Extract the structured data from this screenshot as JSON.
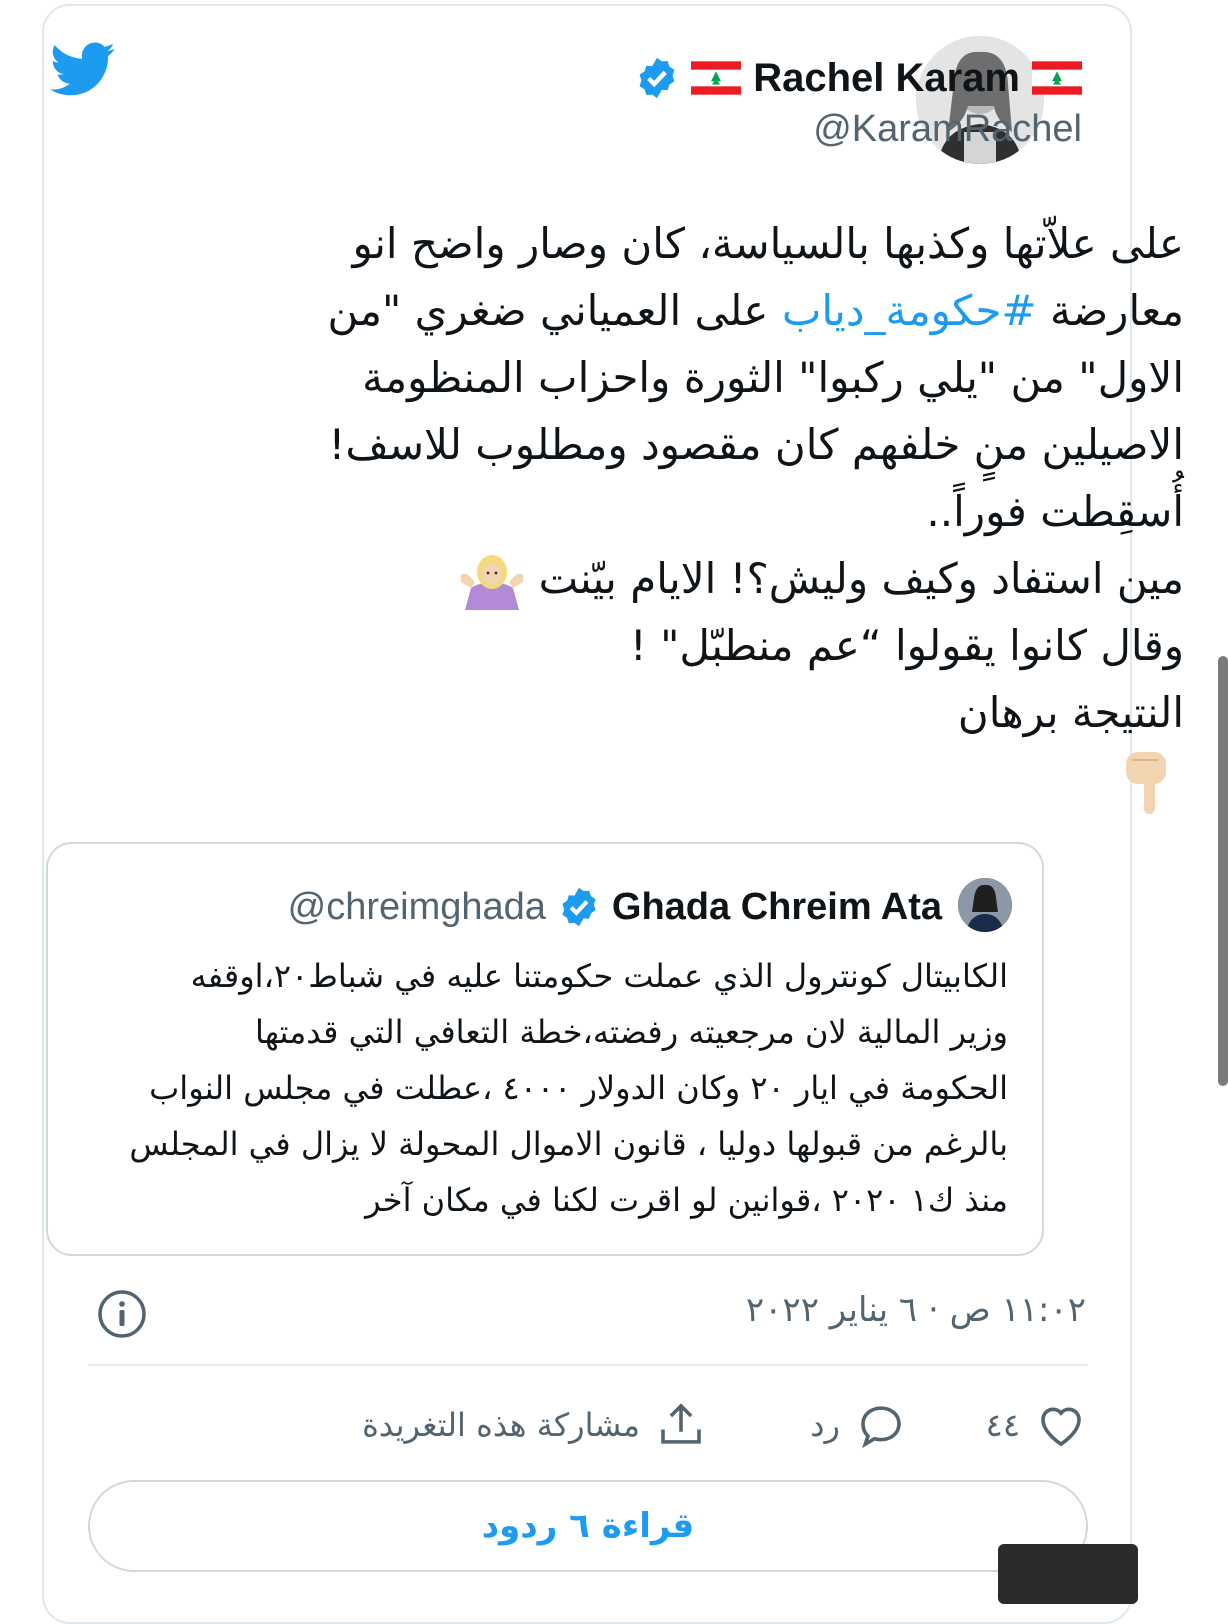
{
  "tweet": {
    "author_name": "Rachel Karam",
    "author_handle": "@KaramRachel",
    "lines": [
      {
        "before": "على علاّتها وكذبها بالسياسة، كان وصار واضح انو",
        "hashtag": "",
        "after": ""
      },
      {
        "before": "معارضة ",
        "hashtag": "#حكومة_دياب",
        "after": " على العمياني ضغري \"من"
      },
      {
        "before": "الاول\" من \"يلي ركبوا\" الثورة واحزاب المنظومة",
        "hashtag": "",
        "after": ""
      },
      {
        "before": "الاصيلين منٍ خلفهم كان مقصود ومطلوب للاسف!",
        "hashtag": "",
        "after": ""
      },
      {
        "before": "أُسقِطت فوراً..",
        "hashtag": "",
        "after": ""
      },
      {
        "before": "مين استفاد وكيف وليش؟! الايام بيّنت",
        "hashtag": "",
        "after": ""
      },
      {
        "before": "وقال كانوا يقولوا “عم منطبّل\" !",
        "hashtag": "",
        "after": ""
      },
      {
        "before": "النتيجة برهان",
        "hashtag": "",
        "after": ""
      }
    ],
    "emojis": [
      "woman-shrugging-emoji",
      "pointing-down-emoji"
    ]
  },
  "quoted_tweet": {
    "author_name": "Ghada Chreim Ata",
    "author_handle": "@chreimghada",
    "lines": [
      "الكابيتال كونترول الذي عملت حكومتنا عليه في شباط٢٠،اوقفه",
      "وزير المالية لان مرجعيته رفضته،خطة التعافي التي قدمتها",
      "الحكومة في ايار ٢٠ وكان الدولار ٤٠٠٠ ،عطلت في مجلس النواب",
      "بالرغم من قبولها دوليا ، قانون الاموال المحولة لا يزال في المجلس",
      "منذ ك١ ٢٠٢٠ ،قوانين لو اقرت لكنا في مكان آخر"
    ]
  },
  "timestamp": "١١:٠٢ ص · ٦ يناير ٢٠٢٢",
  "actions": {
    "likes_count": "٤٤",
    "reply_label": "رد",
    "share_label": "مشاركة هذه التغريدة"
  },
  "read_replies_label": "قراءة ٦ ردود",
  "colors": {
    "accent": "#1d9bf0",
    "text": "#0f1419",
    "secondary": "#536471",
    "border": "#cfd9de"
  },
  "icons": [
    "twitter-bird-icon",
    "verified-badge-icon",
    "lebanon-flag-icon",
    "info-icon",
    "heart-icon",
    "reply-icon",
    "share-icon"
  ]
}
